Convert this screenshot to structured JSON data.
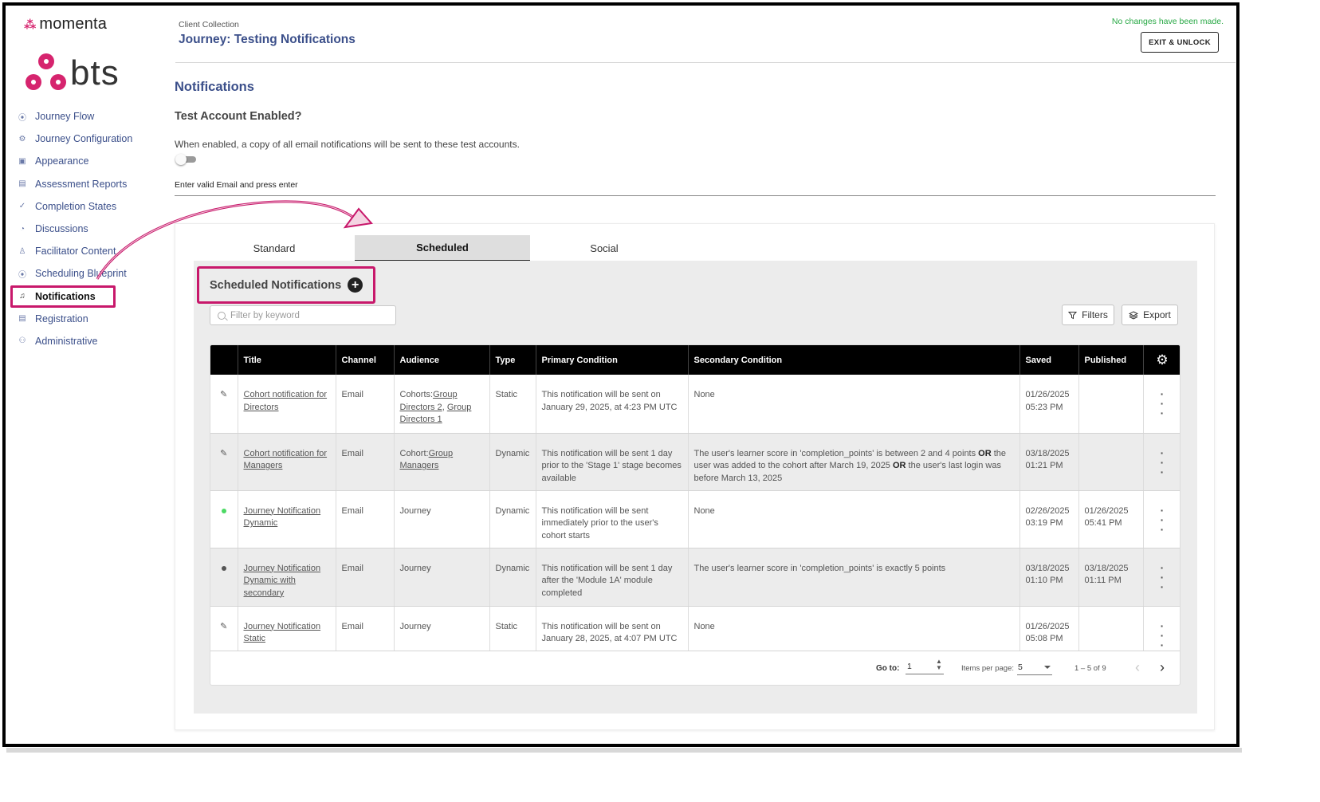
{
  "brand": {
    "mark": "⁂",
    "name": "momenta",
    "logo_text": "bts"
  },
  "sidebar": {
    "items": [
      {
        "label": "Journey Flow",
        "icon": "location-pin-icon",
        "glyph": "⦿",
        "active": false
      },
      {
        "label": "Journey Configuration",
        "icon": "gear-icon",
        "glyph": "⚙",
        "active": false
      },
      {
        "label": "Appearance",
        "icon": "image-icon",
        "glyph": "▣",
        "active": false
      },
      {
        "label": "Assessment Reports",
        "icon": "document-icon",
        "glyph": "▤",
        "active": false
      },
      {
        "label": "Completion States",
        "icon": "check-circle-icon",
        "glyph": "✓",
        "active": false
      },
      {
        "label": "Discussions",
        "icon": "chat-icon",
        "glyph": "◔",
        "active": false
      },
      {
        "label": "Facilitator Content",
        "icon": "person-icon",
        "glyph": "♙",
        "active": false
      },
      {
        "label": "Scheduling Blueprint",
        "icon": "location-pin-icon",
        "glyph": "⦿",
        "active": false
      },
      {
        "label": "Notifications",
        "icon": "bell-icon",
        "glyph": "♫",
        "active": true
      },
      {
        "label": "Registration",
        "icon": "document-icon",
        "glyph": "▤",
        "active": false
      },
      {
        "label": "Administrative",
        "icon": "admin-users-icon",
        "glyph": "⚇",
        "active": false
      }
    ]
  },
  "header": {
    "subtitle": "Client Collection",
    "title": "Journey: Testing Notifications",
    "status": "No changes have been made.",
    "exit_label": "EXIT & UNLOCK"
  },
  "section": {
    "title": "Notifications",
    "test_title": "Test Account Enabled?",
    "test_desc": "When enabled, a copy of all email notifications will be sent to these test accounts.",
    "toggle_on": false,
    "email_label": "Enter valid Email and press enter"
  },
  "tabs": [
    {
      "label": "Standard",
      "active": false
    },
    {
      "label": "Scheduled",
      "active": true
    },
    {
      "label": "Social",
      "active": false
    }
  ],
  "scheduled": {
    "title": "Scheduled Notifications",
    "add_glyph": "+",
    "filter_placeholder": "Filter by keyword",
    "filters_label": "Filters",
    "export_label": "Export"
  },
  "table": {
    "headers": [
      "",
      "Title",
      "Channel",
      "Audience",
      "Type",
      "Primary Condition",
      "Secondary Condition",
      "Saved",
      "Published"
    ],
    "rows": [
      {
        "status": "edit",
        "title": "Cohort notification for Directors",
        "channel": "Email",
        "audience_prefix": "Cohorts:",
        "audience_links": [
          "Group Directors 2",
          "Group Directors 1"
        ],
        "type": "Static",
        "primary": "This notification will be sent on January 29, 2025, at 4:23 PM UTC",
        "secondary": "None",
        "saved_date": "01/26/2025",
        "saved_time": "05:23 PM",
        "published_date": "",
        "published_time": ""
      },
      {
        "status": "edit",
        "title": "Cohort notification for Managers",
        "channel": "Email",
        "audience_prefix": "Cohort:",
        "audience_links": [
          "Group Managers"
        ],
        "type": "Dynamic",
        "primary": "This notification will be sent 1 day prior to the 'Stage 1' stage becomes available",
        "secondary_parts": [
          "The user's learner score in 'completion_points' is between 2 and 4 points ",
          "OR",
          " the user was added to the cohort after March 19, 2025 ",
          "OR",
          " the user's last login was before March 13, 2025"
        ],
        "saved_date": "03/18/2025",
        "saved_time": "01:21 PM",
        "published_date": "",
        "published_time": ""
      },
      {
        "status": "green",
        "title": "Journey Notification Dynamic",
        "channel": "Email",
        "audience": "Journey",
        "type": "Dynamic",
        "primary": "This notification will be sent immediately prior to the user's cohort starts",
        "secondary": "None",
        "saved_date": "02/26/2025",
        "saved_time": "03:19 PM",
        "published_date": "01/26/2025",
        "published_time": "05:41 PM"
      },
      {
        "status": "grey",
        "title": "Journey Notification Dynamic with secondary",
        "channel": "Email",
        "audience": "Journey",
        "type": "Dynamic",
        "primary": "This notification will be sent 1 day after the 'Module 1A' module completed",
        "secondary": "The user's learner score in 'completion_points' is exactly 5 points",
        "saved_date": "03/18/2025",
        "saved_time": "01:10 PM",
        "published_date": "03/18/2025",
        "published_time": "01:11 PM"
      },
      {
        "status": "edit",
        "title": "Journey Notification Static",
        "channel": "Email",
        "audience": "Journey",
        "type": "Static",
        "primary": "This notification will be sent on January 28, 2025, at 4:07 PM UTC",
        "secondary": "None",
        "saved_date": "01/26/2025",
        "saved_time": "05:08 PM",
        "published_date": "",
        "published_time": ""
      }
    ]
  },
  "pager": {
    "goto_label": "Go to:",
    "goto_value": "1",
    "ipp_label": "Items per page:",
    "ipp_value": "5",
    "range": "1 – 5 of 9",
    "prev": "‹",
    "next": "›"
  },
  "colors": {
    "accent": "#c8186b",
    "navy": "#3b4f8a",
    "status_green": "#4cd964",
    "status_grey": "#555555",
    "ok_text": "#27a844"
  }
}
